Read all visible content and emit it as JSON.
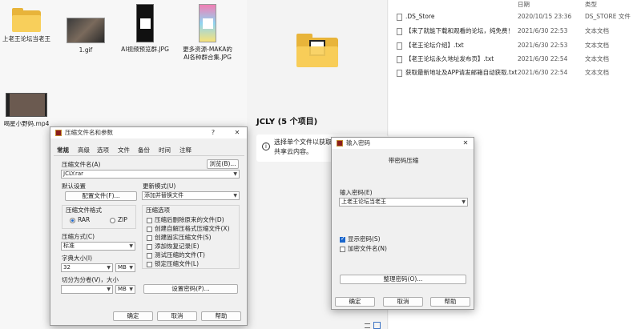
{
  "desktop": {
    "icons": [
      {
        "label": "上老王论坛当老王",
        "icon": "folder-icon"
      },
      {
        "label": "1.gif",
        "icon": "image-thumbnail"
      },
      {
        "label": "AI视频预览群.JPG",
        "icon": "image-thumbnail"
      },
      {
        "label": "更多资源-MAKA的AI各种群合集.JPG",
        "icon": "image-thumbnail"
      },
      {
        "label": "喝星小野妈.mp4",
        "icon": "video-thumbnail"
      }
    ]
  },
  "explorer": {
    "header": {
      "date_col": "日期",
      "type_col": "类型"
    },
    "files": [
      {
        "name": ".DS_Store",
        "date": "2020/10/15 23:36",
        "type": "DS_STORE 文件"
      },
      {
        "name": "【来了就能下载和观看的论坛，纯免费！",
        "date": "2021/6/30 22:53",
        "type": "文本文档"
      },
      {
        "name": "【老王论坛介绍】.txt",
        "date": "2021/6/30 22:53",
        "type": "文本文档"
      },
      {
        "name": "【老王论坛永久地址发布页】.txt",
        "date": "2021/6/30 22:54",
        "type": "文本文档"
      },
      {
        "name": "获取最新地址及APP请发邮箱自动获取.txt",
        "date": "2021/6/30 22:54",
        "type": "文本文档"
      }
    ],
    "preview": {
      "title": "JCLY (5 个项目)",
      "info_line1": "选择单个文件以获取",
      "info_line2": "共享云内容。"
    }
  },
  "archive_dialog": {
    "title": "压缩文件名和参数",
    "help_glyph": "?",
    "close_glyph": "✕",
    "tabs": [
      "常规",
      "高级",
      "选项",
      "文件",
      "备份",
      "时间",
      "注释"
    ],
    "archive_name_label": "压缩文件名(A)",
    "browse_button": "浏览(B)...",
    "archive_name_value": "JCLY.rar",
    "default_settings_label": "默认设置",
    "profiles_button": "配置文件(F)...",
    "update_mode_label": "更新模式(U)",
    "update_mode_value": "添加并替换文件",
    "format_label": "压缩文件格式",
    "format_rar": "RAR",
    "format_zip": "ZIP",
    "options_label": "压缩选项",
    "options": [
      {
        "label": "压缩后删除原来的文件(D)",
        "checked": false
      },
      {
        "label": "创建自解压格式压缩文件(X)",
        "checked": false
      },
      {
        "label": "创建固实压缩文件(S)",
        "checked": false
      },
      {
        "label": "添加恢复记录(E)",
        "checked": false
      },
      {
        "label": "测试压缩的文件(T)",
        "checked": false
      },
      {
        "label": "锁定压缩文件(L)",
        "checked": false
      }
    ],
    "method_label": "压缩方式(C)",
    "method_value": "标准",
    "dict_label": "字典大小(I)",
    "dict_value": "32",
    "dict_unit": "MB",
    "split_label": "切分为分卷(V)，大小",
    "split_value": "",
    "split_unit": "MB",
    "password_button": "设置密码(P)...",
    "ok_button": "确定",
    "cancel_button": "取消",
    "help_button": "帮助"
  },
  "password_dialog": {
    "title": "输入密码",
    "close_glyph": "✕",
    "subtitle": "带密码压缩",
    "enter_label": "输入密码(E)",
    "password_value": "上老王论坛当老王",
    "show_password_label": "显示密码(S)",
    "show_password_checked": true,
    "encrypt_names_label": "加密文件名(N)",
    "encrypt_names_checked": false,
    "organize_button": "整理密码(O)...",
    "ok_button": "确定",
    "cancel_button": "取消",
    "help_button": "帮助"
  }
}
